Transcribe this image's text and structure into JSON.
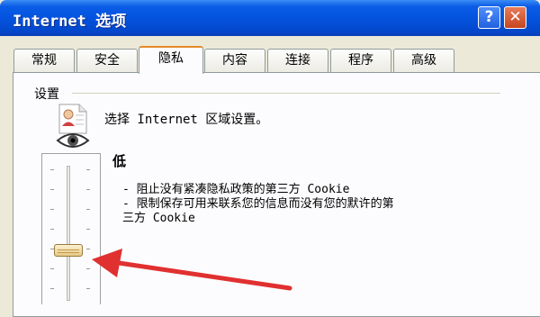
{
  "window": {
    "title": "Internet 选项",
    "help": "?",
    "close": "✕"
  },
  "tabs": [
    {
      "label": "常规"
    },
    {
      "label": "安全"
    },
    {
      "label": "隐私"
    },
    {
      "label": "内容"
    },
    {
      "label": "连接"
    },
    {
      "label": "程序"
    },
    {
      "label": "高级"
    }
  ],
  "active_tab": "隐私",
  "settings": {
    "group_label": "设置",
    "intro": "选择 Internet 区域设置。",
    "level": "低",
    "description": [
      "- 阻止没有紧凑隐私政策的第三方 Cookie",
      "- 限制保存可用来联系您的信息而没有您的默许的第",
      "三方 Cookie"
    ],
    "slider_level_fraction": 0.2
  },
  "colors": {
    "titlebar": "#0453de",
    "active_tab_accent": "#e68b2c",
    "annotation_arrow": "#e03030"
  }
}
